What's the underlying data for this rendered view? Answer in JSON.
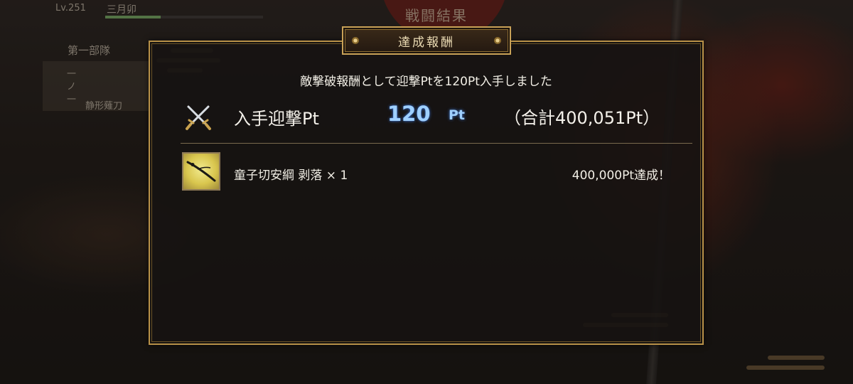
{
  "background": {
    "player_level": "Lv.251",
    "player_name": "三月卯",
    "screen_title": "戦闘結果",
    "squad_name": "第一部隊",
    "squad_rank": "一ノ一",
    "sword_name": "静形薙刀"
  },
  "modal": {
    "title": "達成報酬",
    "message": "敵撃破報酬として迎撃Ptを120Pt入手しました",
    "points": {
      "icon": "crossed-swords-icon",
      "label": "入手迎撃Pt",
      "value": "120",
      "unit": "Pt",
      "total": "（合計400,051Pt）"
    },
    "rewards": [
      {
        "icon": "katana-item-icon",
        "name": "童子切安綱 剥落 × 1",
        "status": "400,000Pt達成！"
      }
    ]
  },
  "colors": {
    "frame_gold": "#b89148",
    "points_blue": "#9fd0ff",
    "text": "#f2efe6"
  }
}
